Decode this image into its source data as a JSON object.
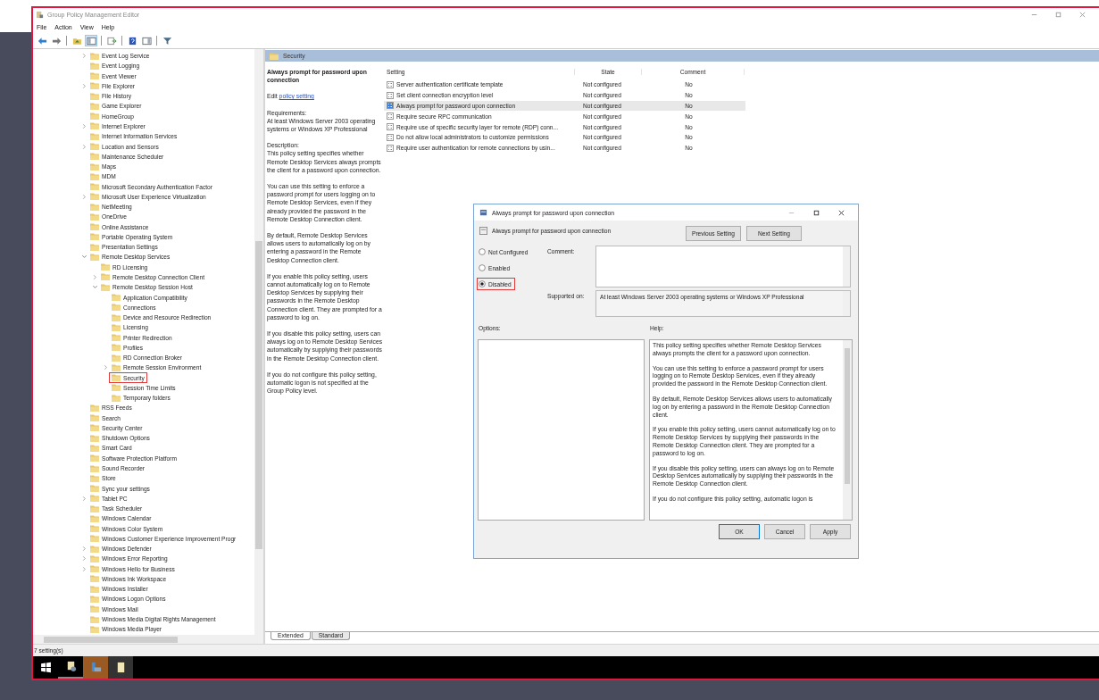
{
  "window": {
    "title": "Group Policy Management Editor"
  },
  "menu": [
    "File",
    "Action",
    "View",
    "Help"
  ],
  "toolbar": [
    {
      "kind": "back",
      "pressed": false
    },
    {
      "kind": "forward",
      "pressed": false
    },
    {
      "kind": "separator"
    },
    {
      "kind": "folder-up",
      "pressed": false
    },
    {
      "kind": "tree-toggle",
      "pressed": true
    },
    {
      "kind": "separator"
    },
    {
      "kind": "export",
      "pressed": false
    },
    {
      "kind": "separator"
    },
    {
      "kind": "help",
      "pressed": false
    },
    {
      "kind": "panel",
      "pressed": false
    },
    {
      "kind": "separator"
    },
    {
      "kind": "filter",
      "pressed": false
    }
  ],
  "tree": {
    "items": [
      {
        "label": "Event Log Service",
        "expanded": false
      },
      {
        "label": "Event Logging"
      },
      {
        "label": "Event Viewer"
      },
      {
        "label": "File Explorer",
        "expanded": false
      },
      {
        "label": "File History"
      },
      {
        "label": "Game Explorer"
      },
      {
        "label": "HomeGroup"
      },
      {
        "label": "Internet Explorer",
        "expanded": false
      },
      {
        "label": "Internet Information Services"
      },
      {
        "label": "Location and Sensors",
        "expanded": false
      },
      {
        "label": "Maintenance Scheduler"
      },
      {
        "label": "Maps"
      },
      {
        "label": "MDM"
      },
      {
        "label": "Microsoft Secondary Authentication Factor"
      },
      {
        "label": "Microsoft User Experience Virtualization",
        "expanded": false
      },
      {
        "label": "NetMeeting"
      },
      {
        "label": "OneDrive"
      },
      {
        "label": "Online Assistance"
      },
      {
        "label": "Portable Operating System"
      },
      {
        "label": "Presentation Settings"
      },
      {
        "label": "Remote Desktop Services",
        "expanded": true,
        "children": [
          {
            "label": "RD Licensing"
          },
          {
            "label": "Remote Desktop Connection Client",
            "expanded": false
          },
          {
            "label": "Remote Desktop Session Host",
            "expanded": true,
            "children": [
              {
                "label": "Application Compatibility"
              },
              {
                "label": "Connections"
              },
              {
                "label": "Device and Resource Redirection"
              },
              {
                "label": "Licensing"
              },
              {
                "label": "Printer Redirection"
              },
              {
                "label": "Profiles"
              },
              {
                "label": "RD Connection Broker"
              },
              {
                "label": "Remote Session Environment",
                "expanded": false
              },
              {
                "label": "Security",
                "annotated": true
              },
              {
                "label": "Session Time Limits"
              },
              {
                "label": "Temporary folders"
              }
            ]
          }
        ]
      },
      {
        "label": "RSS Feeds"
      },
      {
        "label": "Search"
      },
      {
        "label": "Security Center"
      },
      {
        "label": "Shutdown Options"
      },
      {
        "label": "Smart Card"
      },
      {
        "label": "Software Protection Platform"
      },
      {
        "label": "Sound Recorder"
      },
      {
        "label": "Store"
      },
      {
        "label": "Sync your settings"
      },
      {
        "label": "Tablet PC",
        "expanded": false
      },
      {
        "label": "Task Scheduler"
      },
      {
        "label": "Windows Calendar"
      },
      {
        "label": "Windows Color System"
      },
      {
        "label": "Windows Customer Experience Improvement Progr"
      },
      {
        "label": "Windows Defender",
        "expanded": false
      },
      {
        "label": "Windows Error Reporting",
        "expanded": false
      },
      {
        "label": "Windows Hello for Business",
        "expanded": false
      },
      {
        "label": "Windows Ink Workspace"
      },
      {
        "label": "Windows Installer"
      },
      {
        "label": "Windows Logon Options"
      },
      {
        "label": "Windows Mail"
      },
      {
        "label": "Windows Media Digital Rights Management"
      },
      {
        "label": "Windows Media Player"
      }
    ]
  },
  "details": {
    "header": "Security",
    "title": "Always prompt for password upon connection",
    "edit_prefix": "Edit",
    "edit_link": "policy setting",
    "requirements_label": "Requirements:",
    "requirements": "At least Windows Server 2003 operating systems or Windows XP Professional",
    "description_label": "Description:",
    "paragraphs": [
      "This policy setting specifies whether Remote Desktop Services always prompts the client for a password upon connection.",
      "You can use this setting to enforce a password prompt for users logging on to Remote Desktop Services, even if they already provided the password in the Remote Desktop Connection client.",
      "By default, Remote Desktop Services allows users to automatically log on by entering a password in the Remote Desktop Connection client.",
      "If you enable this policy setting, users cannot automatically log on to Remote Desktop Services by supplying their passwords in the Remote Desktop Connection client. They are prompted for a password to log on.",
      "If you disable this policy setting, users can always log on to Remote Desktop Services automatically by supplying their passwords in the Remote Desktop Connection client.",
      "If you do not configure this policy setting, automatic logon is not specified at the Group Policy level."
    ]
  },
  "table": {
    "columns": [
      "Setting",
      "State",
      "Comment"
    ],
    "rows": [
      {
        "setting": "Server authentication certificate template",
        "state": "Not configured",
        "comment": "No",
        "selected": false
      },
      {
        "setting": "Set client connection encryption level",
        "state": "Not configured",
        "comment": "No",
        "selected": false
      },
      {
        "setting": "Always prompt for password upon connection",
        "state": "Not configured",
        "comment": "No",
        "selected": true
      },
      {
        "setting": "Require secure RPC communication",
        "state": "Not configured",
        "comment": "No",
        "selected": false
      },
      {
        "setting": "Require use of specific security layer for remote (RDP) conn...",
        "state": "Not configured",
        "comment": "No",
        "selected": false
      },
      {
        "setting": "Do not allow local administrators to customize permissions",
        "state": "Not configured",
        "comment": "No",
        "selected": false
      },
      {
        "setting": "Require user authentication for remote connections by usin...",
        "state": "Not configured",
        "comment": "No",
        "selected": false
      }
    ]
  },
  "view_tabs": [
    {
      "label": "Extended",
      "selected": true
    },
    {
      "label": "Standard",
      "selected": false
    }
  ],
  "status_bar": "7 setting(s)",
  "taskbar": {
    "apps": [
      {
        "kind": "policy-editor",
        "running": true,
        "selected": false,
        "hovered": false
      },
      {
        "kind": "server-manager",
        "running": false,
        "selected": true,
        "hovered": false
      },
      {
        "kind": "document",
        "running": false,
        "selected": false,
        "hovered": true
      }
    ]
  },
  "dialog": {
    "title": "Always prompt for password upon connection",
    "setting_name": "Always prompt for password upon connection",
    "nav_buttons": [
      "Previous Setting",
      "Next Setting"
    ],
    "options": [
      {
        "label": "Not Configured",
        "selected": false
      },
      {
        "label": "Enabled",
        "selected": false
      },
      {
        "label": "Disabled",
        "selected": true,
        "annotated": true
      }
    ],
    "comment_label": "Comment:",
    "supported_label": "Supported on:",
    "supported": "At least Windows Server 2003 operating systems or Windows XP Professional",
    "options_label": "Options:",
    "help_label": "Help:",
    "help": [
      "This policy setting specifies whether Remote Desktop Services always prompts the client for a password upon connection.",
      "You can use this setting to enforce a password prompt for users logging on to Remote Desktop Services, even if they already provided the password in the Remote Desktop Connection client.",
      "By default, Remote Desktop Services allows users to automatically log on by entering a password in the Remote Desktop Connection client.",
      "If you enable this policy setting, users cannot automatically log on to Remote Desktop Services by supplying their passwords in the Remote Desktop Connection client. They are prompted for a password to log on.",
      "If you disable this policy setting, users can always log on to Remote Desktop Services automatically by supplying their passwords in the Remote Desktop Connection client.",
      "If you do not configure this policy setting, automatic logon is"
    ],
    "buttons": [
      {
        "label": "OK",
        "focused": true
      },
      {
        "label": "Cancel",
        "focused": false
      },
      {
        "label": "Apply",
        "focused": false
      }
    ]
  }
}
